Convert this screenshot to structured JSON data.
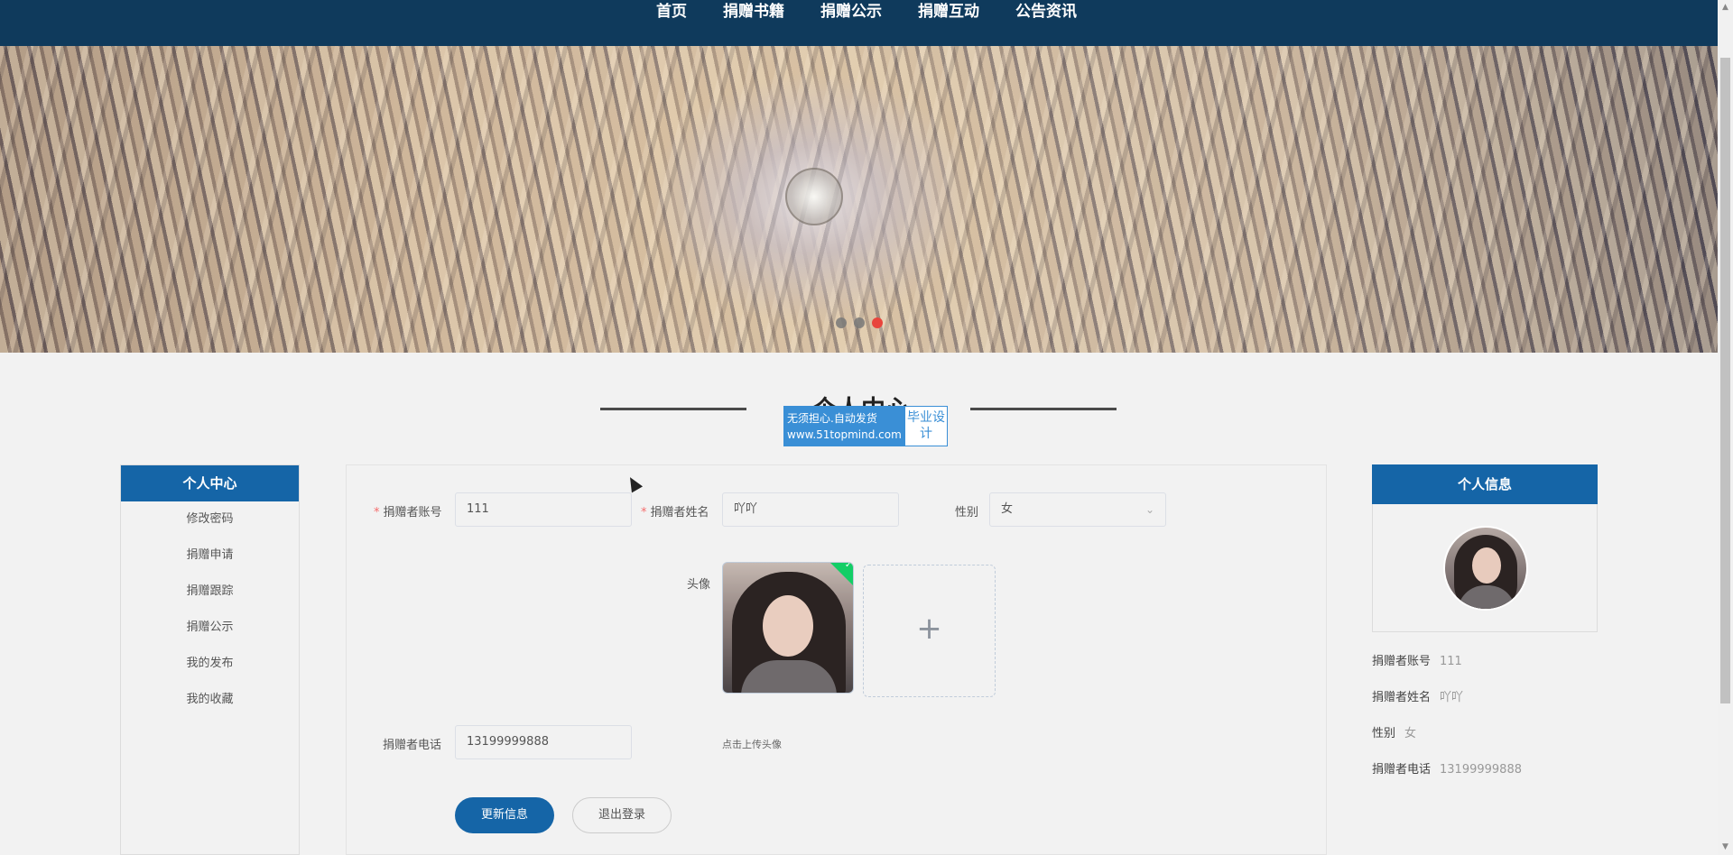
{
  "nav": {
    "items": [
      "首页",
      "捐赠书籍",
      "捐赠公示",
      "捐赠互动",
      "公告资讯"
    ]
  },
  "banner": {
    "slides_count": 3,
    "active_slide": 3,
    "dot_colors": {
      "inactive": "#787878",
      "active": "#e8453c"
    }
  },
  "section": {
    "title": "个人中心"
  },
  "watermark": {
    "line1": "无须担心.自动发货",
    "line2": "www.51topmind.com",
    "right": "毕业设计"
  },
  "sidebar": {
    "title": "个人中心",
    "items": [
      "修改密码",
      "捐赠申请",
      "捐赠跟踪",
      "捐赠公示",
      "我的发布",
      "我的收藏"
    ]
  },
  "form": {
    "account_label": "捐赠者账号",
    "account_value": "111",
    "name_label": "捐赠者姓名",
    "name_value": "吖吖",
    "gender_label": "性别",
    "gender_value": "女",
    "avatar_label": "头像",
    "upload_plus": "+",
    "upload_tip": "点击上传头像",
    "phone_label": "捐赠者电话",
    "phone_value": "13199999888",
    "update_button": "更新信息",
    "logout_button": "退出登录"
  },
  "profile": {
    "title": "个人信息",
    "rows": [
      {
        "key": "捐赠者账号",
        "value": "111"
      },
      {
        "key": "捐赠者姓名",
        "value": "吖吖"
      },
      {
        "key": "性别",
        "value": "女"
      },
      {
        "key": "捐赠者电话",
        "value": "13199999888"
      }
    ]
  },
  "colors": {
    "nav_bg": "#0f3a5c",
    "primary": "#1565a7",
    "required": "#f56c6c",
    "upload_success": "#13ce66"
  }
}
